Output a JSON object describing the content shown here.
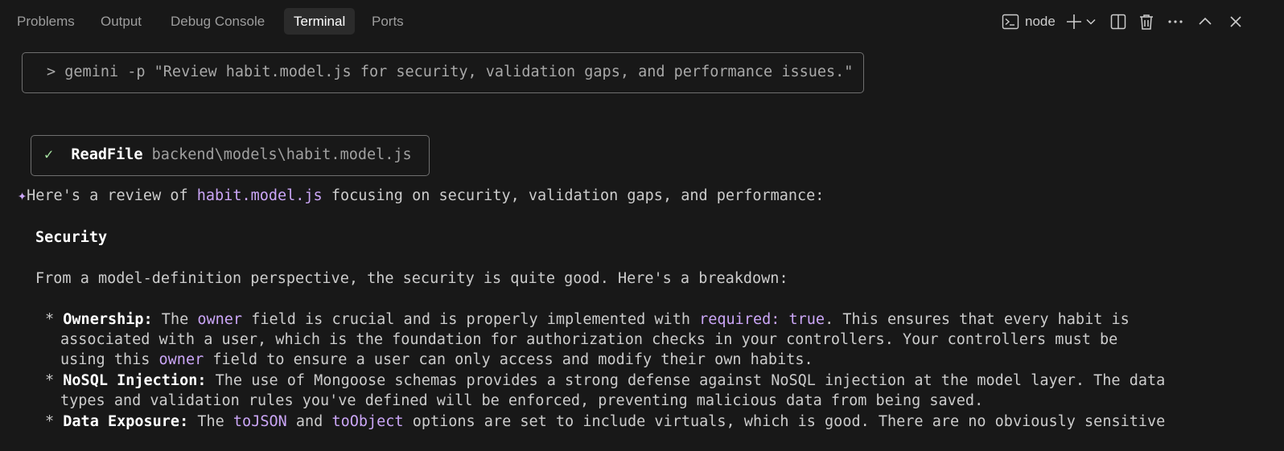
{
  "tabs": [
    {
      "label": "Problems"
    },
    {
      "label": "Output"
    },
    {
      "label": "Debug Console"
    },
    {
      "label": "Terminal",
      "active": true
    },
    {
      "label": "Ports"
    }
  ],
  "toolbar": {
    "shell_name": "node",
    "icons": [
      "terminal-icon",
      "plus-icon",
      "chevron-down-icon",
      "split-icon",
      "trash-icon",
      "ellipsis-icon",
      "chevron-up-icon",
      "close-icon"
    ]
  },
  "terminal": {
    "prompt_marker": ">",
    "command": "gemini -p \"Review habit.model.js for security, validation gaps, and performance issues.\"",
    "tool_call": {
      "check": "✓",
      "name": "ReadFile",
      "arg": "backend\\models\\habit.model.js"
    },
    "response": {
      "sparkle": "✦",
      "intro_a": "Here's a review of ",
      "intro_file": "habit.model.js",
      "intro_b": " focusing on security, validation gaps, and performance:",
      "section_title": "Security",
      "paragraph": "From a model-definition perspective, the security is quite good. Here's a breakdown:",
      "bullets": {
        "ownership": {
          "marker": "*",
          "label": "Ownership:",
          "t1": " The ",
          "code1": "owner",
          "t2": " field is crucial and is properly implemented with ",
          "code2": "required: true",
          "t3": ". This ensures that every habit is",
          "l2": "associated with a user, which is the foundation for authorization checks in your controllers. Your controllers must be",
          "l3a": "using this ",
          "l3code": "owner",
          "l3b": " field to ensure a user can only access and modify their own habits."
        },
        "nosql": {
          "marker": "*",
          "label": "NoSQL Injection:",
          "t1": " The use of Mongoose schemas provides a strong defense against NoSQL injection at the model layer. The data",
          "l2": "types and validation rules you've defined will be enforced, preventing malicious data from being saved."
        },
        "exposure": {
          "marker": "*",
          "label": "Data Exposure:",
          "t1": " The ",
          "code1": "toJSON",
          "t2": " and ",
          "code2": "toObject",
          "t3": " options are set to include virtuals, which is good. There are no obviously sensitive"
        }
      }
    }
  },
  "colors": {
    "background": "#181818",
    "accent": "#cba6f7",
    "success": "#a6e3a1",
    "text": "#cccccc"
  }
}
